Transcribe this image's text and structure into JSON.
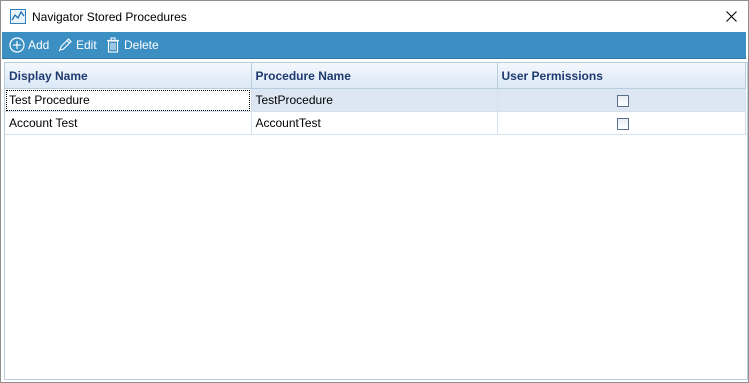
{
  "window": {
    "title": "Navigator Stored Procedures",
    "icon": "chart-app-icon",
    "close_icon": "close-icon"
  },
  "toolbar": {
    "add_label": "Add",
    "edit_label": "Edit",
    "delete_label": "Delete",
    "background_color": "#3c8fc3"
  },
  "table": {
    "columns": [
      "Display Name",
      "Procedure Name",
      "User Permissions"
    ],
    "rows": [
      {
        "display_name": "Test Procedure",
        "procedure_name": "TestProcedure",
        "user_permissions": false
      },
      {
        "display_name": "Account Test",
        "procedure_name": "AccountTest",
        "user_permissions": false
      }
    ]
  }
}
